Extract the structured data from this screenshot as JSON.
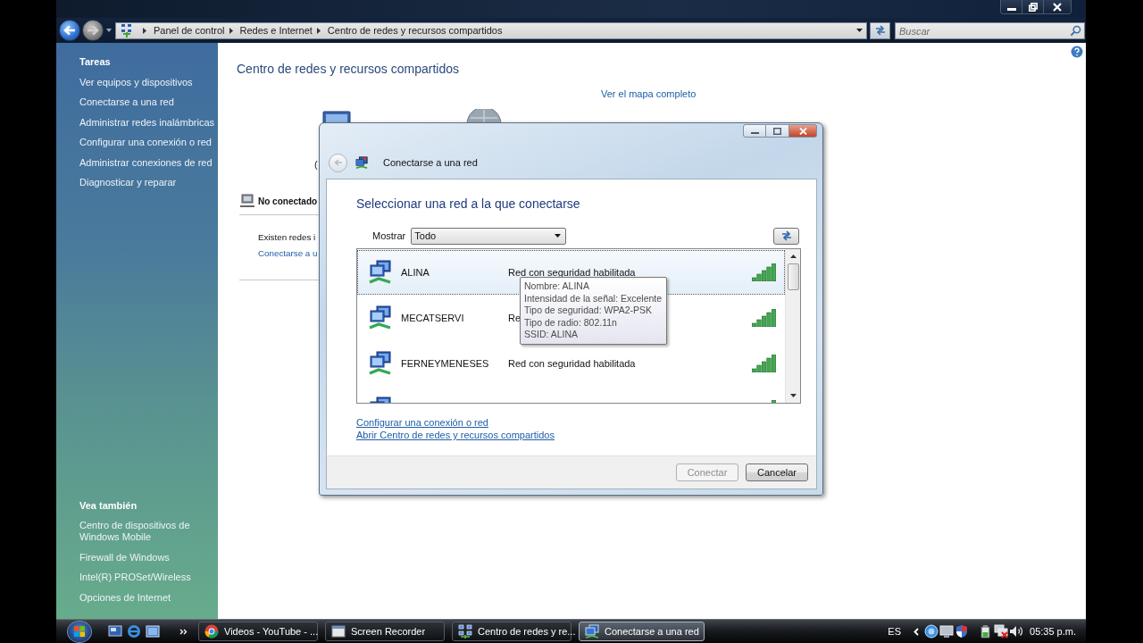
{
  "window": {
    "address_path": [
      "Panel de control",
      "Redes e Internet",
      "Centro de redes y recursos compartidos"
    ],
    "search": {
      "placeholder": "Buscar"
    }
  },
  "sidebar": {
    "sections": [
      {
        "title": "Tareas",
        "items": [
          "Ver equipos y dispositivos",
          "Conectarse a una red",
          "Administrar redes inalámbricas",
          "Configurar una conexión o red",
          "Administrar conexiones de red",
          "Diagnosticar y reparar"
        ]
      },
      {
        "title": "Vea también",
        "items": [
          "Centro de dispositivos de Windows Mobile",
          "Firewall de Windows",
          "Intel(R) PROSet/Wireless",
          "Opciones de Internet"
        ]
      }
    ]
  },
  "content": {
    "title": "Centro de redes y recursos compartidos",
    "map_link": "Ver el mapa completo",
    "map_label": "(",
    "status": "No conectado",
    "message": "Existen redes i",
    "link": "Conectarse a u"
  },
  "dialog": {
    "title": "Conectarse a una red",
    "heading": "Seleccionar una red a la que conectarse",
    "filter": {
      "label": "Mostrar",
      "value": "Todo"
    },
    "networks": [
      {
        "name": "ALINA",
        "status": "Red con seguridad habilitada",
        "selected": true
      },
      {
        "name": "MECATSERVI",
        "status": "Re",
        "selected": false
      },
      {
        "name": "FERNEYMENESES",
        "status": "Red con seguridad habilitada",
        "selected": false
      },
      {
        "selected": false
      }
    ],
    "tooltip": [
      "Nombre: ALINA",
      "Intensidad de la señal: Excelente",
      "Tipo de seguridad: WPA2-PSK",
      "Tipo de radio: 802.11n",
      "SSID: ALINA"
    ],
    "links": [
      "Configurar una conexión o red",
      "Abrir Centro de redes y recursos compartidos"
    ],
    "buttons": [
      {
        "label": "Conectar",
        "disabled": true
      },
      {
        "label": "Cancelar",
        "disabled": false
      }
    ]
  },
  "taskbar": {
    "tasks": [
      {
        "label": "Videos - YouTube - ...",
        "kind": "browser",
        "selected": false
      },
      {
        "label": "Screen Recorder",
        "kind": "window",
        "selected": false
      },
      {
        "label": "Centro de redes y re...",
        "kind": "network",
        "selected": false
      },
      {
        "label": "Conectarse a una red",
        "kind": "wizard",
        "selected": true
      }
    ],
    "language": "ES",
    "clock": "05:35 p.m."
  }
}
